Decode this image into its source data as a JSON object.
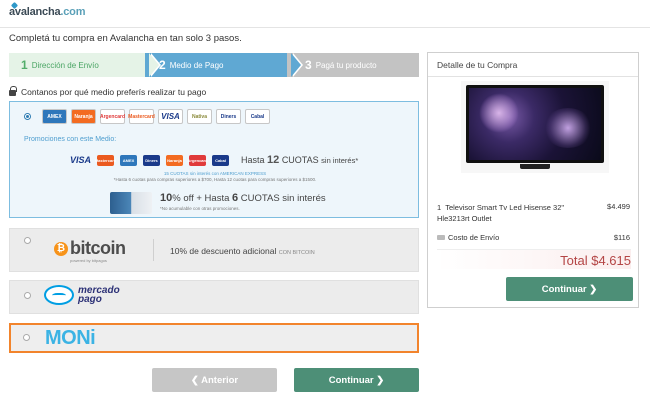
{
  "header": {
    "logo_main": "avalancha",
    "logo_suffix": ".com",
    "headline": "Completá tu compra en Avalancha en tan solo 3 pasos."
  },
  "steps": [
    {
      "num": "1",
      "label": "Dirección de Envío",
      "state": "done"
    },
    {
      "num": "2",
      "label": "Medio de Pago",
      "state": "active"
    },
    {
      "num": "3",
      "label": "Pagá tu producto",
      "state": "pending"
    }
  ],
  "payment": {
    "question": "Contanos por qué medio preferís realizar tu pago",
    "card_option": {
      "selected": true,
      "card_logos": [
        "AMEX",
        "Naranja",
        "Argencard",
        "Mastercard",
        "VISA",
        "Nativa",
        "Diners",
        "Cabal"
      ],
      "promo_title": "Promociones con este Medio:",
      "promo_cards": [
        "VISA",
        "Mastercard",
        "AMEX",
        "Diners",
        "Naranja",
        "Argencard",
        "Cabal"
      ],
      "cuotas_prefix": "Hasta",
      "cuotas_num": "12",
      "cuotas_suffix": "CUOTAS",
      "cuotas_note": "sin interés",
      "cuotas_mark": "*",
      "fine_blue": "15 CUOTAS sin interés con AMERICAN EXPRESS",
      "fine_gray": "*Hasta 6 cuotas para compras superiores a $700, Hasta 12 cuotas para compras superiores a $1500.",
      "promo2_pct": "10",
      "promo2_off": "% off + Hasta",
      "promo2_num": "6",
      "promo2_cuotas": "CUOTAS sin interés",
      "promo2_note": "*No acumulable con otras promociones."
    },
    "bitcoin_option": {
      "logo_symbol": "₿",
      "logo_text": "bitcoin",
      "powered": "powered by bitpagos",
      "desc": "10% de descuento adicional",
      "desc_small": "CON BITCOIN"
    },
    "mercadopago_option": {
      "line1": "mercado",
      "line2": "pago"
    },
    "moni_option": {
      "logo_text": "MONi",
      "highlighted_color": "#f2842c"
    }
  },
  "buttons": {
    "prev": "❮ Anterior",
    "next": "Continuar ❯",
    "summary_next": "Continuar ❯"
  },
  "summary": {
    "title": "Detalle de tu Compra",
    "product_image": "tv-icon",
    "product_qty": "1",
    "product_name": "Televisor Smart Tv Led Hisense 32\" Hle3213rt Outlet",
    "product_price": "$4.499",
    "shipping_label": "Costo de Envío",
    "shipping_price": "$116",
    "total": "Total $4.615"
  },
  "colors": {
    "step_done": "#e5f3e7",
    "step_active": "#5fa8d3",
    "step_pending": "#c3c3c3",
    "primary_button": "#4d8f77",
    "total_text": "#b44545"
  }
}
